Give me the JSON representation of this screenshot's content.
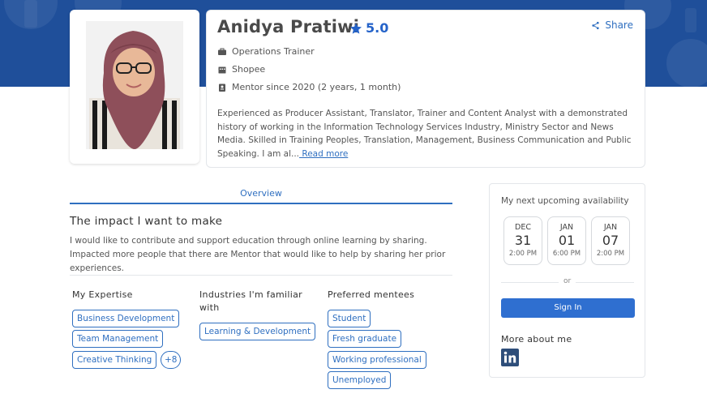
{
  "profile": {
    "name": "Anidya Pratiwi",
    "rating": "5.0",
    "share_label": "Share",
    "role": "Operations Trainer",
    "company": "Shopee",
    "mentor_since": "Mentor since 2020 (2 years, 1 month)",
    "bio": "Experienced as Producer Assistant, Translator, Trainer and Content Analyst with a demonstrated history of working in the Information Technology Services Industry, Ministry Sector and News Media. Skilled in Training Peoples, Translation, Management, Business Communication and Public Speaking. I am al...",
    "read_more": " Read more"
  },
  "tabs": [
    {
      "label": "Overview"
    }
  ],
  "impact": {
    "title": "The impact I want to make",
    "text": "I would like to contribute and support education through online learning by sharing. Impacted more people that there are Mentor that would like to help by sharing her prior experiences."
  },
  "expertise": {
    "title": "My Expertise",
    "tags": [
      "Business Development",
      "Team Management",
      "Creative Thinking"
    ],
    "more": "+8"
  },
  "industries": {
    "title": "Industries I'm familiar with",
    "tags": [
      "Learning & Development"
    ]
  },
  "mentees": {
    "title": "Preferred mentees",
    "tags": [
      "Student",
      "Fresh graduate",
      "Working professional",
      "Unemployed"
    ]
  },
  "availability": {
    "title": "My next upcoming availability",
    "slots": [
      {
        "month": "DEC",
        "day": "31",
        "time": "2:00 PM"
      },
      {
        "month": "JAN",
        "day": "01",
        "time": "6:00 PM"
      },
      {
        "month": "JAN",
        "day": "07",
        "time": "2:00 PM"
      }
    ],
    "or_label": "or",
    "signin_label": "Sign In",
    "more_title": "More about me"
  },
  "colors": {
    "banner": "#1f4f9a",
    "accent": "#2f6fc0",
    "button": "#2f6fd0"
  },
  "icons": [
    "star-icon",
    "share-icon",
    "briefcase-icon",
    "building-icon",
    "badge-icon",
    "linkedin-icon"
  ]
}
